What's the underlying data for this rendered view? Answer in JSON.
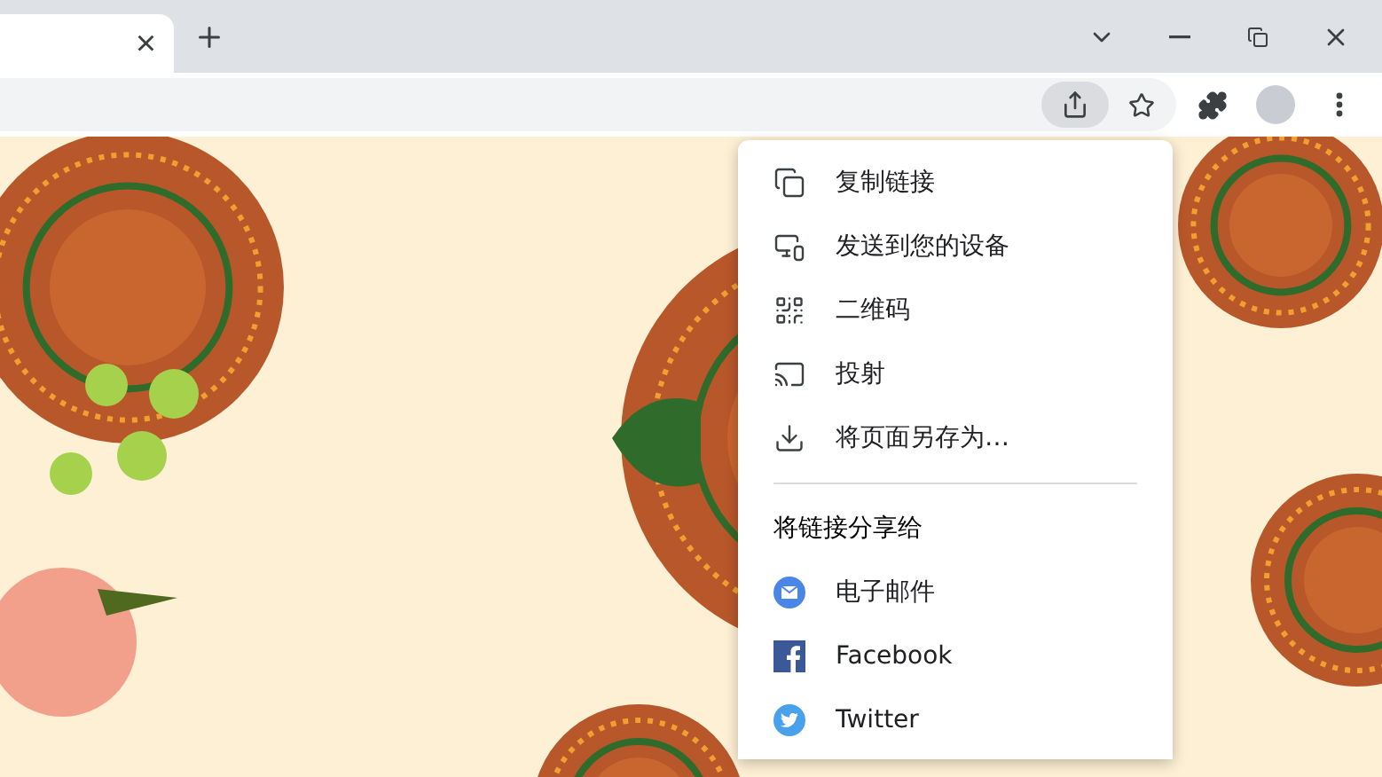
{
  "tabs": [
    {
      "close": "×"
    }
  ],
  "share_menu": {
    "items": [
      "复制链接",
      "发送到您的设备",
      "二维码",
      "投射",
      "将页面另存为…"
    ],
    "share_header": "将链接分享给",
    "targets": [
      "电子邮件",
      "Facebook",
      "Twitter"
    ]
  }
}
